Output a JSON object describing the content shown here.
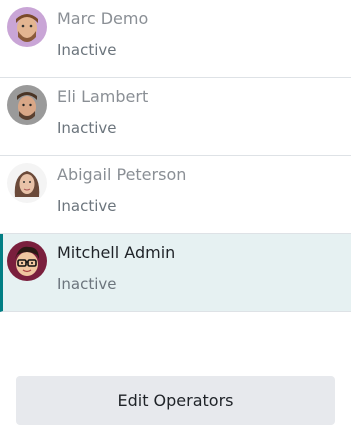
{
  "operators": [
    {
      "name": "Marc Demo",
      "status": "Inactive",
      "avatar_icon": "marc-demo-avatar"
    },
    {
      "name": "Eli Lambert",
      "status": "Inactive",
      "avatar_icon": "eli-lambert-avatar"
    },
    {
      "name": "Abigail Peterson",
      "status": "Inactive",
      "avatar_icon": "abigail-peterson-avatar"
    },
    {
      "name": "Mitchell Admin",
      "status": "Inactive",
      "avatar_icon": "mitchell-admin-avatar",
      "selected": true
    }
  ],
  "actions": {
    "edit_operators_label": "Edit Operators"
  },
  "colors": {
    "selected_bg": "#e6f1f2",
    "selected_accent": "#017e84",
    "button_bg": "#e7e9ed"
  }
}
